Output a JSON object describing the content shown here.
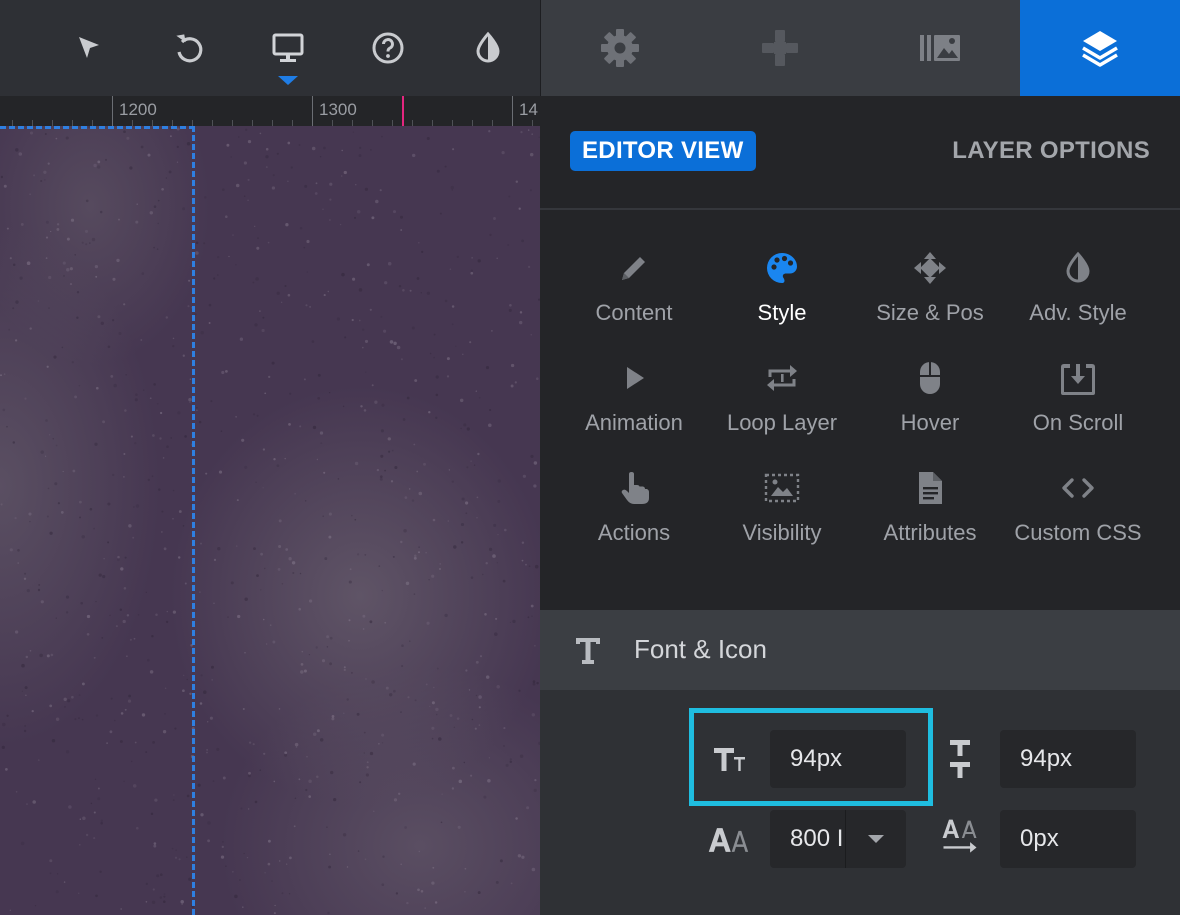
{
  "toolbar": {
    "tools": [
      {
        "icon": "cursor-arrow-icon",
        "label": "Select"
      },
      {
        "icon": "undo-icon",
        "label": "Undo"
      },
      {
        "icon": "desktop-monitor-icon",
        "label": "Desktop view",
        "active": true
      },
      {
        "icon": "help-circle-icon",
        "label": "Help"
      },
      {
        "icon": "contrast-drop-icon",
        "label": "Theme"
      }
    ]
  },
  "ruler": {
    "labels": [
      "1200",
      "1300",
      "14"
    ]
  },
  "panel_tabs": [
    {
      "icon": "gear-icon",
      "active": false
    },
    {
      "icon": "puzzle-icon",
      "active": false
    },
    {
      "icon": "media-library-icon",
      "active": false
    },
    {
      "icon": "layers-icon",
      "active": true
    }
  ],
  "view_switch": {
    "editor_view": "EDITOR VIEW",
    "layer_options": "LAYER OPTIONS"
  },
  "options": [
    {
      "icon": "pencil-icon",
      "label": "Content"
    },
    {
      "icon": "palette-icon",
      "label": "Style",
      "active": true
    },
    {
      "icon": "move-arrows-icon",
      "label": "Size & Pos"
    },
    {
      "icon": "contrast-drop-icon",
      "label": "Adv. Style"
    },
    {
      "icon": "play-icon",
      "label": "Animation"
    },
    {
      "icon": "loop-icon",
      "label": "Loop Layer"
    },
    {
      "icon": "mouse-icon",
      "label": "Hover"
    },
    {
      "icon": "download-tray-icon",
      "label": "On Scroll"
    },
    {
      "icon": "hand-pointer-icon",
      "label": "Actions"
    },
    {
      "icon": "image-dashed-icon",
      "label": "Visibility"
    },
    {
      "icon": "document-icon",
      "label": "Attributes"
    },
    {
      "icon": "code-brackets-icon",
      "label": "Custom CSS"
    }
  ],
  "font_section": {
    "title": "Font & Icon",
    "font_size": "94px",
    "line_height": "94px",
    "font_weight": "800 I",
    "letter_spacing": "0px"
  },
  "colors": {
    "accent": "#0b6fd8",
    "highlight": "#1fbde0",
    "ruler_marker": "#e3267f",
    "canvas": "#463751"
  }
}
